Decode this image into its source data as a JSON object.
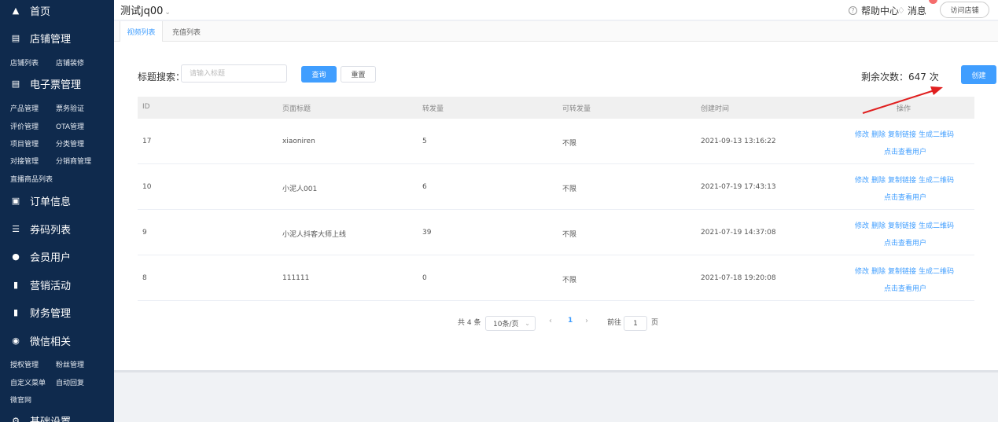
{
  "sidebar": {
    "home": "首页",
    "store_mgmt": "店铺管理",
    "store_list": "店铺列表",
    "store_decor": "店铺装修",
    "eticket_mgmt": "电子票管理",
    "product_mgmt": "产品管理",
    "ticket_verify": "票务验证",
    "review_mgmt": "评价管理",
    "ota_mgmt": "OTA管理",
    "project_mgmt": "项目管理",
    "category_mgmt": "分类管理",
    "docking_mgmt": "对接管理",
    "distributor_mgmt": "分销商管理",
    "live_products": "直播商品列表",
    "order_info": "订单信息",
    "coupon_list": "券码列表",
    "members": "会员用户",
    "marketing": "营销活动",
    "finance": "财务管理",
    "wechat": "微信相关",
    "auth_mgmt": "授权管理",
    "fans_mgmt": "粉丝管理",
    "custom_menu": "自定义菜单",
    "auto_reply": "自动回复",
    "micro_site": "微官网",
    "basic_settings": "基础设置"
  },
  "topbar": {
    "shop_name": "测试jq00",
    "help_center": "帮助中心",
    "messages": "消息",
    "visit_store": "访问店铺"
  },
  "tabs": [
    "视频列表",
    "充值列表"
  ],
  "search": {
    "label": "标题搜索：",
    "placeholder": "请输入标题",
    "query_btn": "查询",
    "reset_btn": "重置"
  },
  "remaining": "剩余次数：647 次",
  "create_btn": "创建",
  "table": {
    "headers": [
      "ID",
      "页面标题",
      "转发量",
      "可转发量",
      "创建时间",
      "操作"
    ],
    "rows": [
      {
        "id": "17",
        "title": "xiaoniren",
        "forwards": "5",
        "available": "不限",
        "created": "2021-09-13 13:16:22"
      },
      {
        "id": "10",
        "title": "小泥人001",
        "forwards": "6",
        "available": "不限",
        "created": "2021-07-19 17:43:13"
      },
      {
        "id": "9",
        "title": "小泥人抖客大师上线",
        "forwards": "39",
        "available": "不限",
        "created": "2021-07-19 14:37:08"
      },
      {
        "id": "8",
        "title": "111111",
        "forwards": "0",
        "available": "不限",
        "created": "2021-07-18 19:20:08"
      }
    ],
    "actions": {
      "edit": "修改",
      "delete": "删除",
      "copy_link": "复制链接",
      "gen_qr": "生成二维码",
      "view_users": "点击查看用户"
    }
  },
  "pagination": {
    "total": "共 4 条",
    "page_size": "10条/页",
    "current": "1",
    "goto_prefix": "前往",
    "goto_value": "1",
    "goto_suffix": "页"
  },
  "colors": {
    "sidebar_bg": "#0f2a4d",
    "primary": "#409eff",
    "arrow": "#e02020"
  }
}
